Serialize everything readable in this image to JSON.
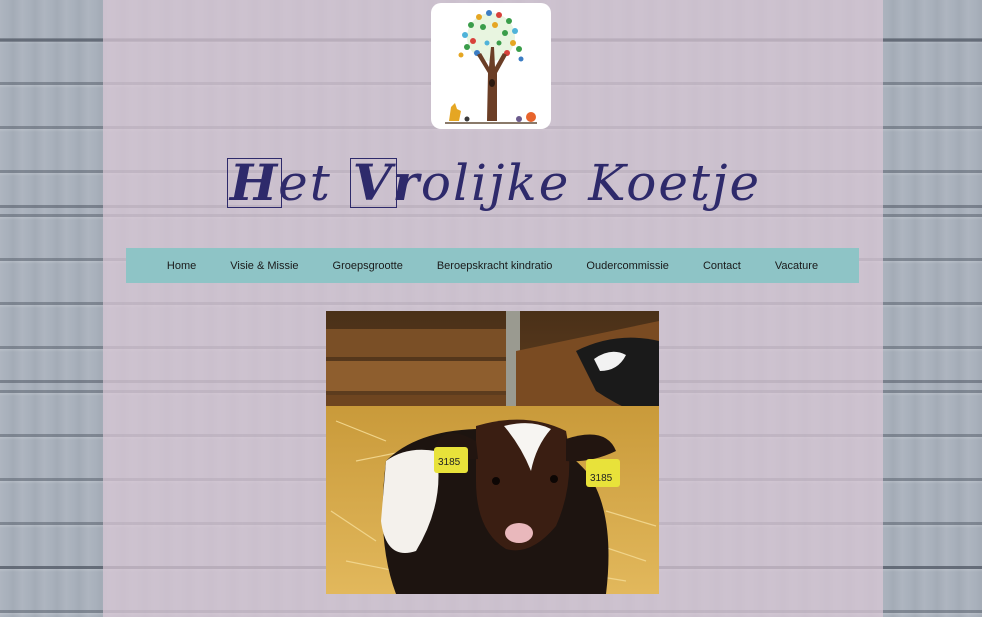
{
  "site": {
    "title": "Het Vrolijke Koetje",
    "title_first_boxed": "H",
    "title_part1": "et ",
    "title_second_boxed": "V",
    "title_part2": "r",
    "title_part3": "olijke ",
    "title_part4": "Koetje"
  },
  "nav": {
    "items": [
      {
        "label": "Home"
      },
      {
        "label": "Visie & Missie"
      },
      {
        "label": "Groepsgrootte"
      },
      {
        "label": "Beroepskracht kindratio"
      },
      {
        "label": "Oudercommissie"
      },
      {
        "label": "Contact"
      },
      {
        "label": "Vacature"
      }
    ]
  },
  "photo": {
    "ear_tag_left": "3185",
    "ear_tag_right": "3185"
  },
  "colors": {
    "nav_bg": "#8ec4c6",
    "title": "#2e2a6b",
    "panel": "#dac8d6"
  }
}
